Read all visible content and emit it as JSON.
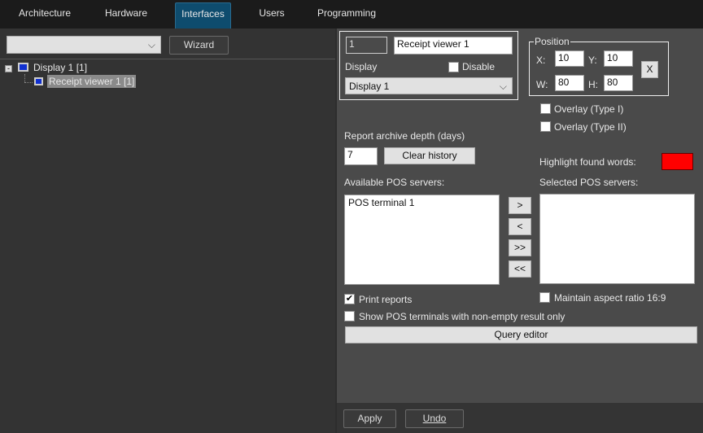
{
  "tabs": [
    "Architecture",
    "Hardware",
    "Interfaces",
    "Users",
    "Programming"
  ],
  "active_tab": "Interfaces",
  "left": {
    "filter_value": "",
    "wizard": "Wizard",
    "tree": [
      {
        "label": "Display 1 [1]",
        "expanded": true
      },
      {
        "label": "Receipt viewer 1 [1]",
        "selected": true
      }
    ]
  },
  "right": {
    "id": "1",
    "name": "Receipt viewer 1",
    "display_label": "Display",
    "disable_label": "Disable",
    "disable_checked": false,
    "display_value": "Display 1",
    "position": {
      "title": "Position",
      "x_label": "X:",
      "y_label": "Y:",
      "w_label": "W:",
      "h_label": "H:",
      "x": "10",
      "y": "10",
      "w": "80",
      "h": "80",
      "reset": "X"
    },
    "overlay1": "Overlay (Type I)",
    "overlay2": "Overlay (Type II)",
    "archive_label": "Report archive depth (days)",
    "archive_value": "7",
    "clear_history": "Clear history",
    "highlight_label": "Highlight found words:",
    "highlight_color": "#ff0000",
    "available_label": "Available POS servers:",
    "available": [
      "POS terminal 1"
    ],
    "selected_label": "Selected POS servers:",
    "move": [
      ">",
      "<",
      ">>",
      "<<"
    ],
    "print_reports": "Print reports",
    "print_checked": true,
    "aspect": "Maintain aspect ratio 16:9",
    "show_nonempty": "Show POS terminals with non-empty result only",
    "query_editor": "Query editor"
  },
  "bottom": {
    "apply": "Apply",
    "undo": "Undo"
  }
}
